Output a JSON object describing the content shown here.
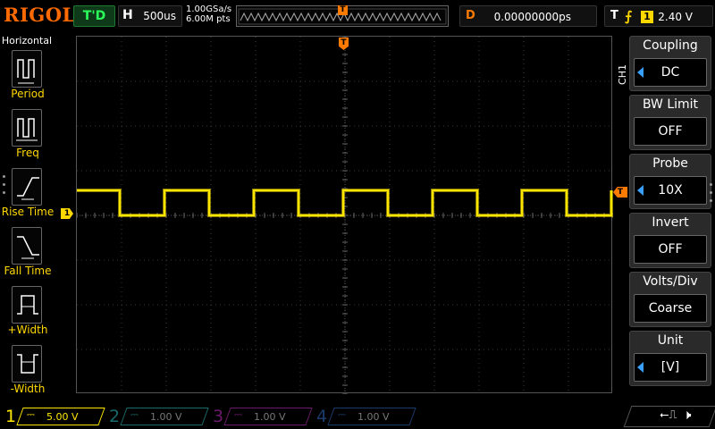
{
  "topbar": {
    "brand": "RIGOL",
    "trigger_status": "T'D",
    "horizontal_letter": "H",
    "timebase": "500us",
    "sample_rate": "1.00GSa/s",
    "memory_depth": "6.00M pts",
    "trigger_position_marker": "T",
    "delay_letter": "D",
    "delay_value": "0.00000000ps",
    "trigger_letter": "T",
    "trigger_edge_icon": "rising-edge-icon",
    "trigger_source": "1",
    "trigger_level": "2.40 V"
  },
  "left_panel": {
    "title": "Horizontal",
    "items": [
      {
        "label": "Period",
        "icon": "period-icon"
      },
      {
        "label": "Freq",
        "icon": "frequency-icon"
      },
      {
        "label": "Rise Time",
        "icon": "rise-time-icon"
      },
      {
        "label": "Fall Time",
        "icon": "fall-time-icon"
      },
      {
        "label": "+Width",
        "icon": "positive-width-icon"
      },
      {
        "label": "-Width",
        "icon": "negative-width-icon"
      }
    ]
  },
  "grid": {
    "trigger_marker": "T",
    "ch1_marker": "1",
    "trigger_level_marker": "T",
    "waveform_color": "#ffe600"
  },
  "right_menu": {
    "channel": "CH1",
    "items": [
      {
        "title": "Coupling",
        "value": "DC",
        "has_arrow": true
      },
      {
        "title": "BW Limit",
        "value": "OFF",
        "has_arrow": false
      },
      {
        "title": "Probe",
        "value": "10X",
        "has_arrow": true
      },
      {
        "title": "Invert",
        "value": "OFF",
        "has_arrow": false
      },
      {
        "title": "Volts/Div",
        "value": "Coarse",
        "has_arrow": false
      },
      {
        "title": "Unit",
        "value": "[V]",
        "has_arrow": true
      }
    ]
  },
  "channels": [
    {
      "num": "1",
      "coupling": "DC",
      "scale": "5.00 V",
      "color": "#ffe600",
      "active": true
    },
    {
      "num": "2",
      "coupling": "DC",
      "scale": "1.00 V",
      "color": "#1a6b6b",
      "active": false
    },
    {
      "num": "3",
      "coupling": "DC",
      "scale": "1.00 V",
      "color": "#6b1a6b",
      "active": false
    },
    {
      "num": "4",
      "coupling": "DC",
      "scale": "1.00 V",
      "color": "#1a3b6b",
      "active": false
    }
  ],
  "status_icons": [
    "usb-icon",
    "speaker-muted-icon"
  ]
}
